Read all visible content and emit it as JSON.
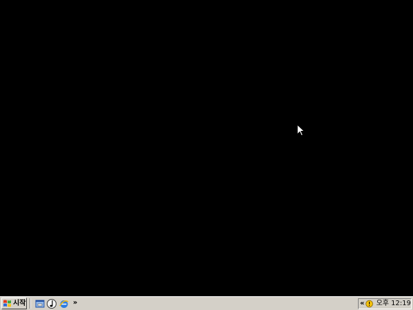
{
  "taskbar": {
    "start_label": "시작",
    "quick_launch_more": "»",
    "quick_launch": [
      {
        "icon": "show-desktop-icon"
      },
      {
        "icon": "windows-media-player-icon"
      },
      {
        "icon": "internet-explorer-icon"
      }
    ]
  },
  "tray": {
    "expand_label": "«",
    "clock": "오후 12:19",
    "icons": [
      "notification-warning-icon"
    ]
  },
  "colors": {
    "desktop": "#000000",
    "taskbar": "#d4d0c8"
  }
}
